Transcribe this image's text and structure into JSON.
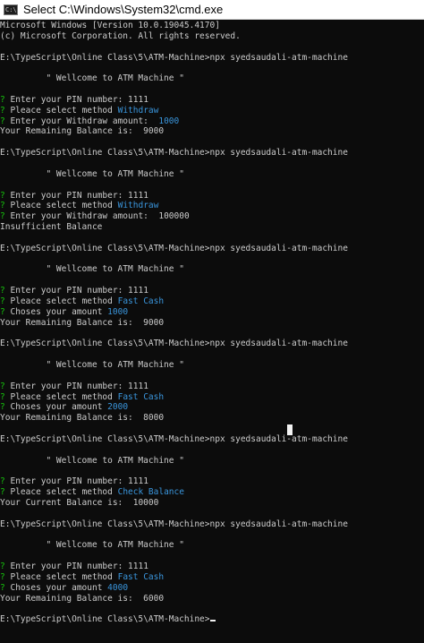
{
  "window": {
    "icon_text": "C:\\",
    "title": "Select C:\\Windows\\System32\\cmd.exe"
  },
  "terminal": {
    "header": [
      "Microsoft Windows [Version 10.0.19045.4170]",
      "(c) Microsoft Corporation. All rights reserved."
    ],
    "prompt": "E:\\TypeScript\\Online Class\\5\\ATM-Machine>",
    "command": "npx syedsaudali-atm-machine",
    "welcome": "\" Wellcome to ATM Machine \"",
    "q": "?",
    "pin_label": "Enter your PIN number:",
    "pin_value": "1111",
    "method_label": "Pleace select method",
    "withdraw_label": "Enter your Withdraw amount:",
    "chooses_label": "Choses your amount",
    "remaining_label": "Your Remaining Balance is:",
    "current_label": "Your Current Balance is:",
    "insufficient": "Insufficient Balance",
    "sessions": {
      "s1": {
        "method": "Withdraw",
        "amount": "1000",
        "balance": "9000"
      },
      "s2": {
        "method": "Withdraw",
        "amount": "100000"
      },
      "s3": {
        "method": "Fast Cash",
        "amount": "1000",
        "balance": "9000"
      },
      "s4": {
        "method": "Fast Cash",
        "amount": "2000",
        "balance": "8000"
      },
      "s5": {
        "method": "Check Balance",
        "balance": "10000"
      },
      "s6": {
        "method": "Fast Cash",
        "amount": "4000",
        "balance": "6000"
      }
    }
  }
}
